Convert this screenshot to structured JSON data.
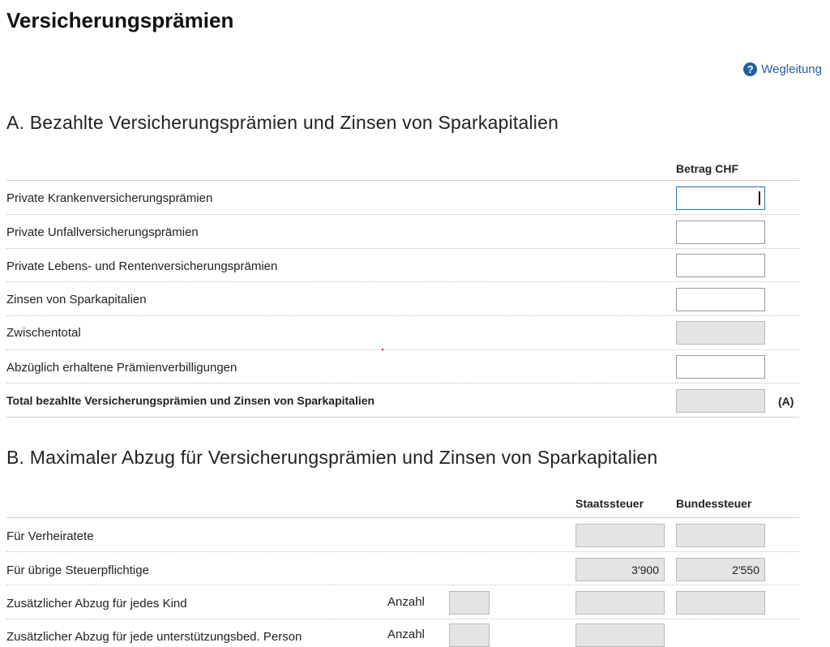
{
  "page": {
    "title": "Versicherungsprämien",
    "help_link": "Wegleitung",
    "help_icon": "question-circle-icon",
    "accent_color": "#1f5fa6"
  },
  "section_a": {
    "title": "A. Bezahlte Versicherungsprämien und Zinsen von Sparkapitalien",
    "column_header": "Betrag CHF",
    "rows": [
      {
        "label": "Private Krankenversicherungsprämien",
        "value": ""
      },
      {
        "label": "Private Unfallversicherungsprämien",
        "value": ""
      },
      {
        "label": "Private Lebens- und Rentenversicherungsprämien",
        "value": ""
      },
      {
        "label": "Zinsen von Sparkapitalien",
        "value": ""
      },
      {
        "label": "Zwischentotal",
        "value": ""
      },
      {
        "label": "Abzüglich erhaltene Prämienverbilligungen",
        "value": ""
      },
      {
        "label": "Total bezahlte Versicherungsprämien und Zinsen von Sparkapitalien",
        "value": "",
        "suffix": "(A)"
      }
    ]
  },
  "section_b": {
    "title": "B. Maximaler Abzug für Versicherungsprämien und Zinsen von Sparkapitalien",
    "column_headers": {
      "state": "Staatssteuer",
      "federal": "Bundessteuer"
    },
    "count_label": "Anzahl",
    "rows": [
      {
        "label": "Für Verheiratete",
        "state": "",
        "federal": ""
      },
      {
        "label": "Für übrige Steuerpflichtige",
        "state": "3'900",
        "federal": "2'550"
      },
      {
        "label": "Zusätzlicher Abzug für jedes Kind",
        "count": "",
        "state": "",
        "federal": ""
      },
      {
        "label": "Zusätzlicher Abzug für jede unterstützungsbed. Person",
        "count": "",
        "state": ""
      }
    ]
  }
}
